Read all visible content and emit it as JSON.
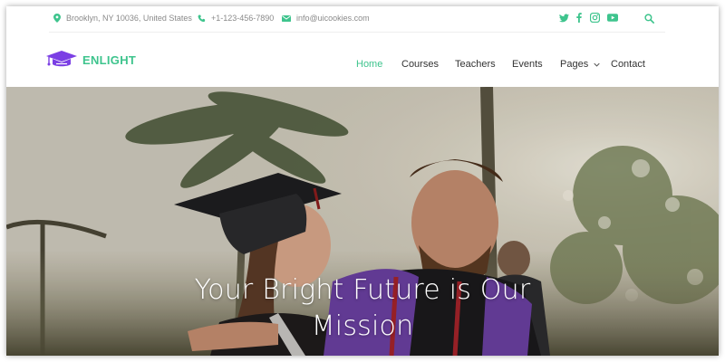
{
  "topbar": {
    "address": "Brooklyn, NY 10036, United States",
    "phone": "+1-123-456-7890",
    "email": "info@uicookies.com",
    "social": [
      "twitter-icon",
      "facebook-icon",
      "instagram-icon",
      "youtube-icon"
    ],
    "accent": "#3ec48d"
  },
  "brand": {
    "name": "ENLIGHT",
    "logo_color": "#7b3fe4"
  },
  "nav": {
    "items": [
      "Home",
      "Courses",
      "Teachers",
      "Events",
      "Pages",
      "Contact"
    ],
    "active": "Home"
  },
  "hero": {
    "title_line1": "Your Bright Future is Our",
    "title_line2": "Mission"
  }
}
